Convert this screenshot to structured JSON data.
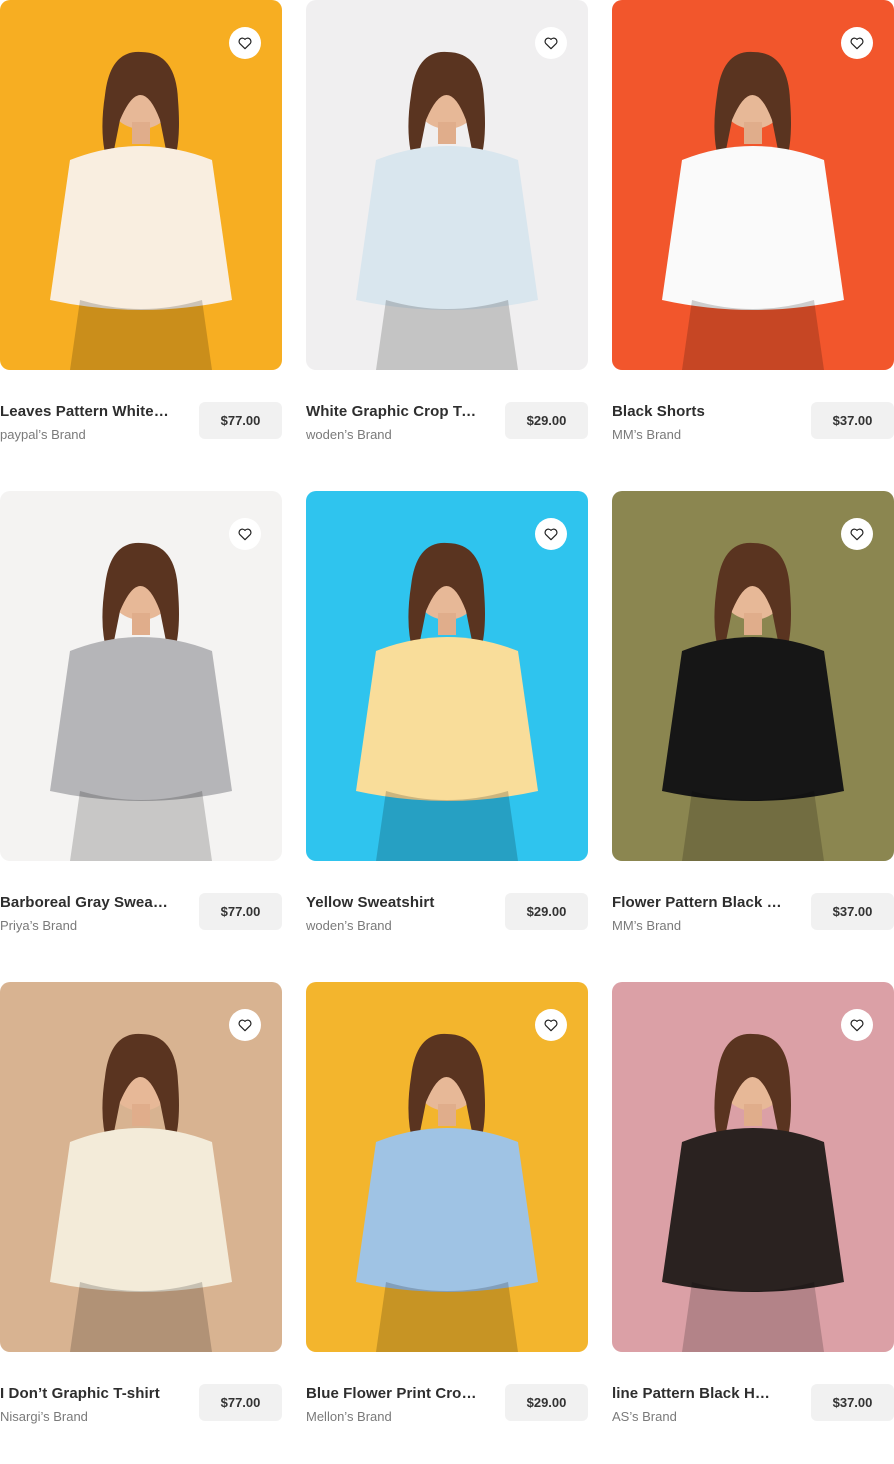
{
  "products": [
    {
      "name": "Leaves Pattern White…",
      "brand": "paypal’s  Brand",
      "price": "$77.00",
      "bg": "#f7ae22",
      "accent": "#f9eee0",
      "icon": "heart-icon"
    },
    {
      "name": "White Graphic Crop Top",
      "brand": "woden’s  Brand",
      "price": "$29.00",
      "bg": "#f0eff0",
      "accent": "#d9e6ee",
      "icon": "heart-icon"
    },
    {
      "name": "Black Shorts",
      "brand": "MM’s  Brand",
      "price": "$37.00",
      "bg": "#f2562c",
      "accent": "#fafafa",
      "icon": "heart-icon"
    },
    {
      "name": "Barboreal Gray Sweats…",
      "brand": "Priya’s  Brand",
      "price": "$77.00",
      "bg": "#f4f3f2",
      "accent": "#b5b5b8",
      "icon": "heart-icon"
    },
    {
      "name": "Yellow Sweatshirt",
      "brand": "woden’s  Brand",
      "price": "$29.00",
      "bg": "#2fc4ee",
      "accent": "#f9dd9a",
      "icon": "heart-icon"
    },
    {
      "name": "Flower Pattern Black C…",
      "brand": "MM’s  Brand",
      "price": "$37.00",
      "bg": "#8b8650",
      "accent": "#161616",
      "icon": "heart-icon"
    },
    {
      "name": "I Don’t Graphic T-shirt",
      "brand": "Nisargi’s  Brand",
      "price": "$77.00",
      "bg": "#d8b391",
      "accent": "#f3ebd9",
      "icon": "heart-icon"
    },
    {
      "name": "Blue Flower Print Crop …",
      "brand": "Mellon’s  Brand",
      "price": "$29.00",
      "bg": "#f3b52d",
      "accent": "#9fc3e4",
      "icon": "heart-icon"
    },
    {
      "name": "line Pattern Black H…",
      "brand": "AS’s  Brand",
      "price": "$37.00",
      "bg": "#dba0a6",
      "accent": "#2a2220",
      "icon": "heart-icon"
    }
  ]
}
